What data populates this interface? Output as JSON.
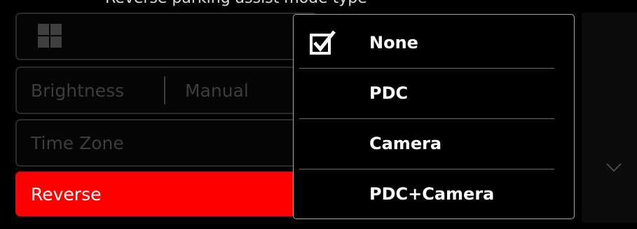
{
  "hint": {
    "text": "Reverse parking assist mode type"
  },
  "menu": {
    "grid_icon": "grid-icon",
    "brightness_label": "Brightness",
    "brightness_value": "Manual",
    "timezone_label": "Time Zone",
    "reverse_label": "Reverse"
  },
  "popup": {
    "options": [
      {
        "label": "None",
        "checked": true
      },
      {
        "label": "PDC",
        "checked": false
      },
      {
        "label": "Camera",
        "checked": false
      },
      {
        "label": "PDC+Camera",
        "checked": false
      }
    ]
  },
  "scroll": {
    "icon": "chevron-down-icon"
  },
  "colors": {
    "accent": "#ff0000",
    "background": "#000000",
    "dim_text": "#3d3d3d",
    "text": "#ffffff"
  }
}
